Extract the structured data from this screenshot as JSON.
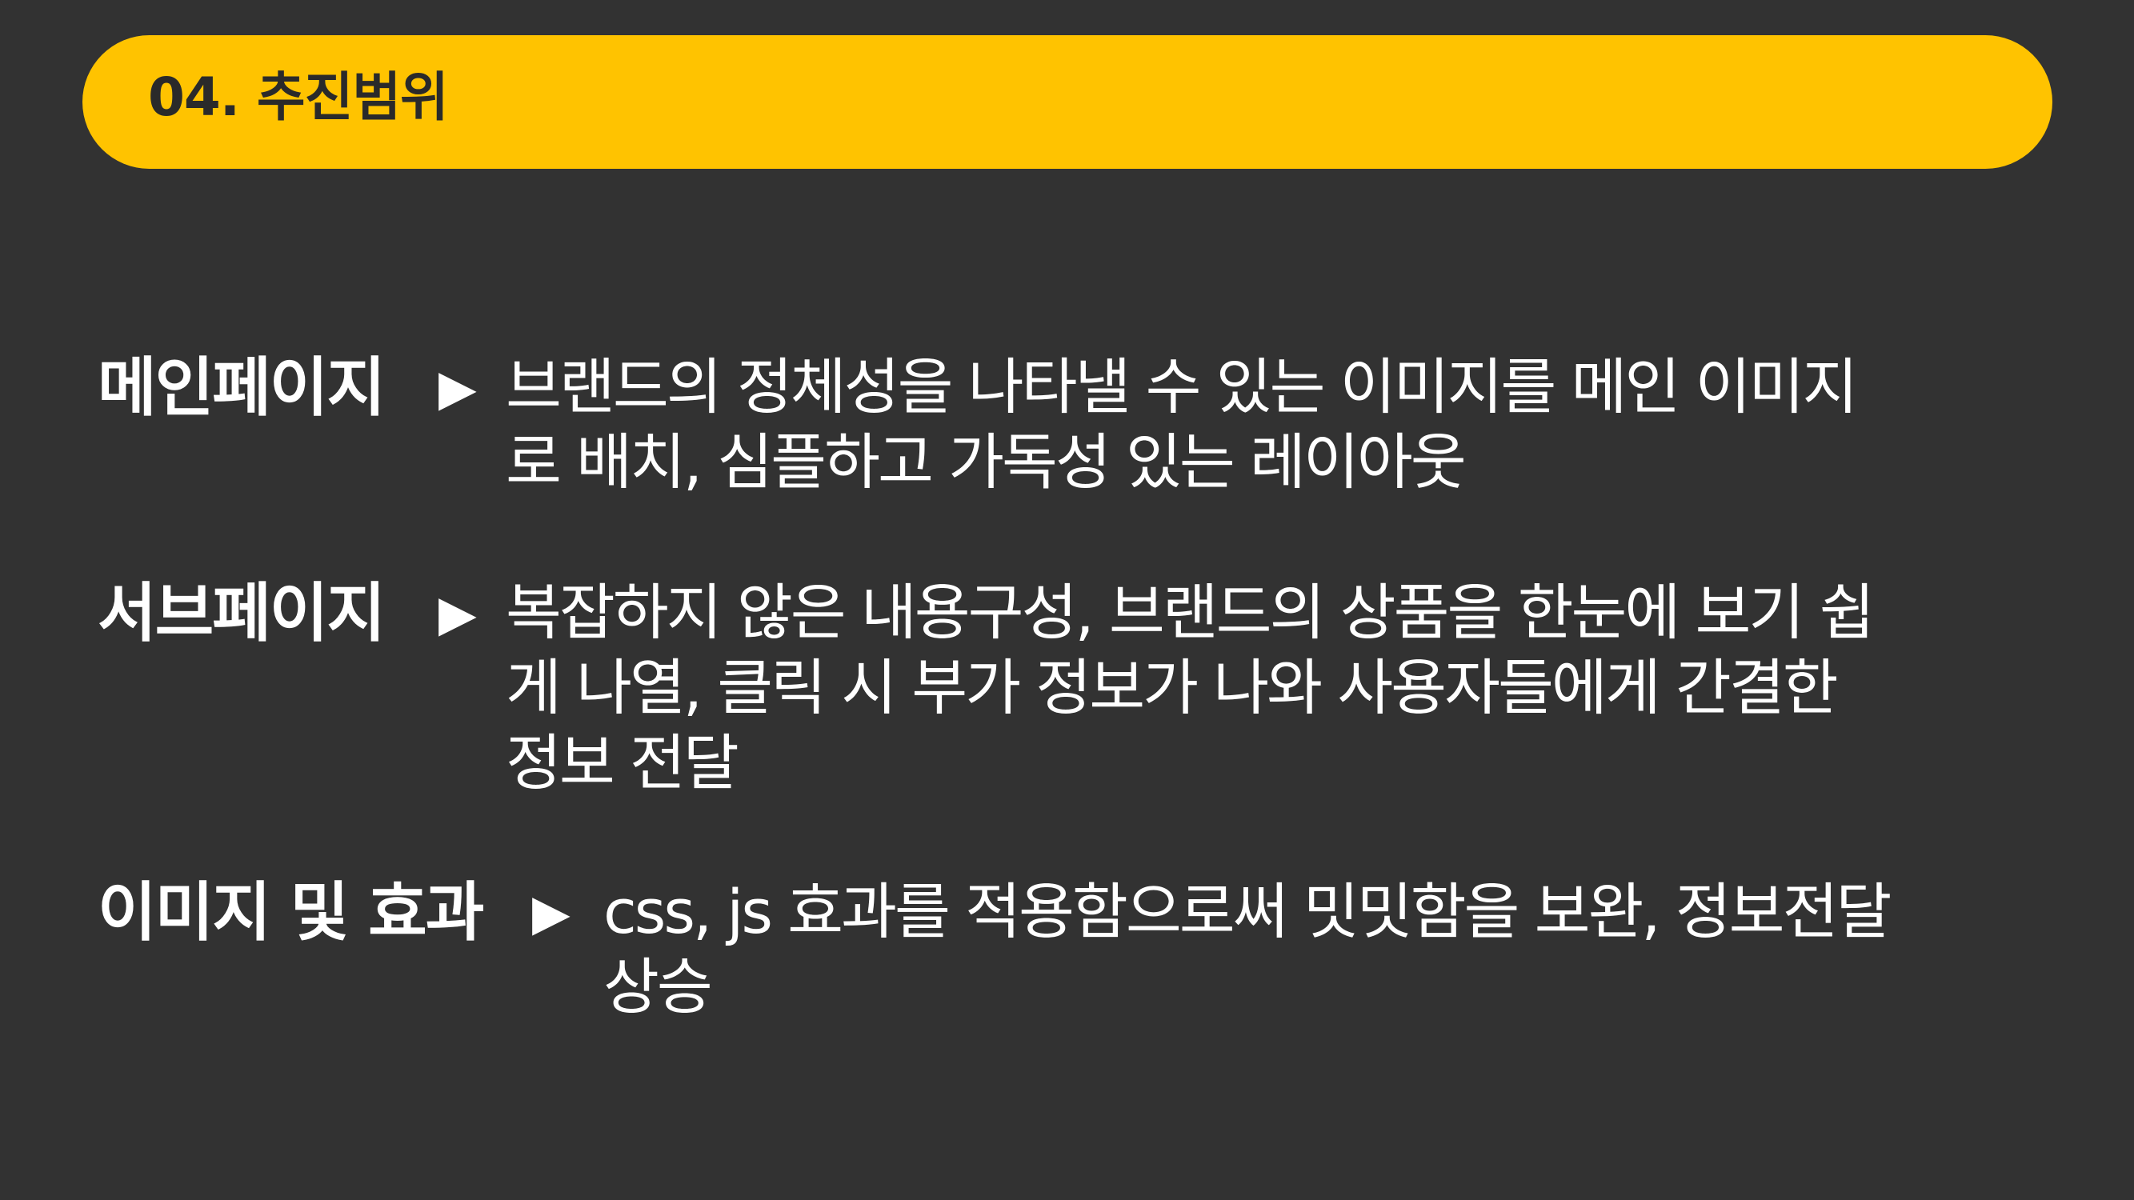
{
  "slide": {
    "title": "04. 추진범위",
    "arrow_glyph": "▶",
    "accent_color": "#FFC300",
    "background_color": "#323232",
    "items": [
      {
        "label": "메인페이지",
        "lines": [
          "브랜드의 정체성을 나타낼 수 있는 이미지를 메인 이미지",
          " 로 배치, 심플하고 가독성 있는 레이아웃"
        ]
      },
      {
        "label": "서브페이지",
        "lines": [
          "복잡하지 않은 내용구성, 브랜드의 상품을 한눈에 보기 쉽",
          "게 나열, 클릭 시 부가 정보가 나와 사용자들에게 간결한",
          "정보 전달"
        ]
      },
      {
        "label": "이미지 및 효과",
        "lines": [
          "css, js 효과를 적용함으로써 밋밋함을 보완, 정보전달",
          "상승"
        ]
      }
    ]
  }
}
